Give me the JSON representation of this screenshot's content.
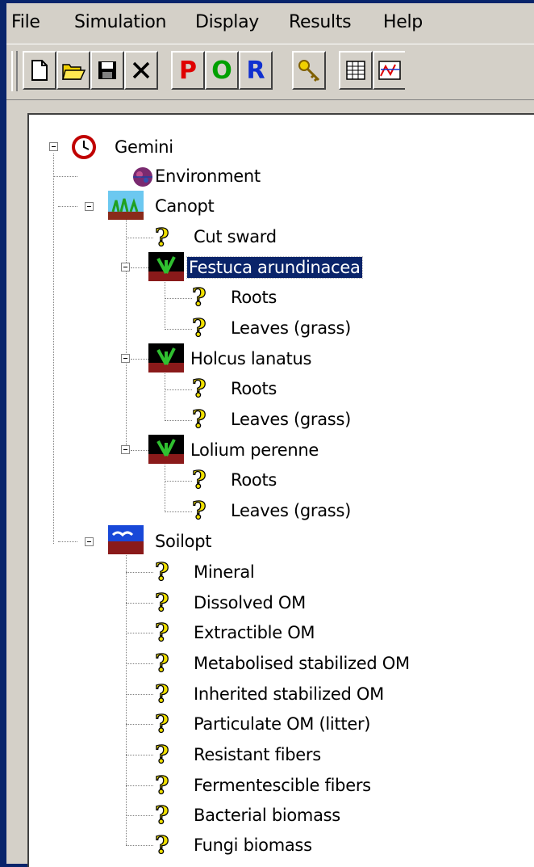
{
  "menu": [
    "File",
    "Simulation",
    "Display",
    "Results",
    "Help"
  ],
  "toolbar": {
    "p_label": "P",
    "o_label": "O",
    "r_label": "R"
  },
  "colors": {
    "selection": "#0a246a",
    "p": "#e00000",
    "o": "#00a000",
    "r": "#1030d0"
  },
  "tree": {
    "root": "Gemini",
    "environment": "Environment",
    "canopt": "Canopt",
    "cut_sward": "Cut sward",
    "festuca": "Festuca arundinacea",
    "holcus": "Holcus lanatus",
    "lolium": "Lolium perenne",
    "roots": "Roots",
    "leaves": "Leaves (grass)",
    "soilopt": "Soilopt",
    "soil_items": [
      "Mineral",
      "Dissolved OM",
      "Extractible OM",
      "Metabolised stabilized OM",
      "Inherited stabilized OM",
      "Particulate OM (litter)",
      "Resistant fibers",
      "Fermentescible fibers",
      "Bacterial biomass",
      "Fungi biomass"
    ],
    "selected": "Festuca arundinacea"
  }
}
